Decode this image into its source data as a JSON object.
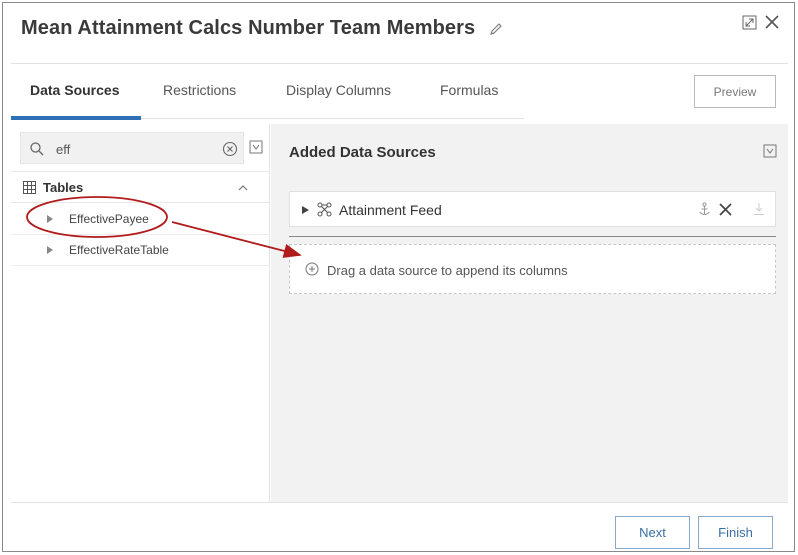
{
  "dialog": {
    "title": "Mean Attainment Calcs Number Team Members"
  },
  "tabs": [
    {
      "label": "Data Sources",
      "active": true
    },
    {
      "label": "Restrictions",
      "active": false
    },
    {
      "label": "Display Columns",
      "active": false
    },
    {
      "label": "Formulas",
      "active": false
    }
  ],
  "toolbar": {
    "preview_label": "Preview"
  },
  "search": {
    "value": "eff",
    "placeholder": ""
  },
  "tables": {
    "header": "Tables",
    "items": [
      {
        "label": "EffectivePayee",
        "highlighted": true
      },
      {
        "label": "EffectiveRateTable",
        "highlighted": false
      }
    ]
  },
  "added_sources": {
    "title": "Added Data Sources",
    "items": [
      {
        "label": "Attainment Feed"
      }
    ],
    "drop_hint": "Drag a data source to append its columns"
  },
  "footer": {
    "next_label": "Next",
    "finish_label": "Finish"
  },
  "icons": {
    "edit": "pencil-icon",
    "expand": "expand-icon",
    "close": "close-icon",
    "search": "search-icon",
    "clear": "clear-circle-icon",
    "filter": "filter-icon",
    "table": "table-grid-icon",
    "collapse": "chevron-up-icon",
    "caret": "caret-right-icon",
    "feed": "data-feed-icon",
    "anchor": "anchor-icon",
    "remove": "remove-icon",
    "download": "download-icon",
    "add": "plus-circle-icon"
  },
  "colors": {
    "accent": "#2f6fb5",
    "annotation": "#b01c1c",
    "button_text": "#3a6ea5"
  }
}
